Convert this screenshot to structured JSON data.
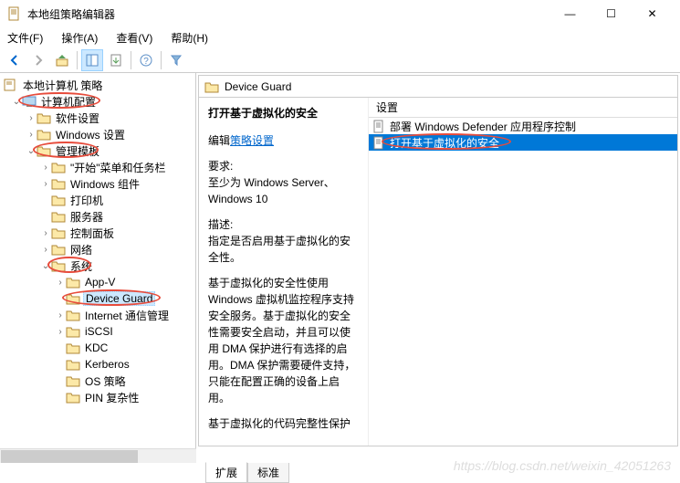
{
  "window": {
    "title": "本地组策略编辑器",
    "min": "—",
    "max": "☐",
    "close": "✕"
  },
  "menu": {
    "file": "文件(F)",
    "action": "操作(A)",
    "view": "查看(V)",
    "help": "帮助(H)"
  },
  "tree": {
    "root": "本地计算机 策略",
    "computer_config": "计算机配置",
    "software_settings": "软件设置",
    "windows_settings": "Windows 设置",
    "admin_templates": "管理模板",
    "start_taskbar": "\"开始\"菜单和任务栏",
    "windows_components": "Windows 组件",
    "printers": "打印机",
    "servers": "服务器",
    "control_panel": "控制面板",
    "network": "网络",
    "system": "系统",
    "appv": "App-V",
    "device_guard": "Device Guard",
    "internet_comm": "Internet 通信管理",
    "iscsi": "iSCSI",
    "kdc": "KDC",
    "kerberos": "Kerberos",
    "os_policies": "OS 策略",
    "pin": "PIN 复杂性"
  },
  "right": {
    "header": "Device Guard",
    "title": "打开基于虚拟化的安全",
    "edit_label": "编辑",
    "edit_link": "策略设置",
    "req_label": "要求:",
    "req_text": "至少为 Windows Server、Windows 10",
    "desc_label": "描述:",
    "desc_text": "指定是否启用基于虚拟化的安全性。",
    "para1": "基于虚拟化的安全性使用 Windows 虚拟机监控程序支持安全服务。基于虚拟化的安全性需要安全启动，并且可以使用 DMA 保护进行有选择的启用。DMA 保护需要硬件支持，只能在配置正确的设备上启用。",
    "para2": "基于虚拟化的代码完整性保护"
  },
  "list": {
    "header": "设置",
    "item1": "部署 Windows Defender 应用程序控制",
    "item2": "打开基于虚拟化的安全"
  },
  "tabs": {
    "extended": "扩展",
    "standard": "标准"
  },
  "watermark": "https://blog.csdn.net/weixin_42051263"
}
